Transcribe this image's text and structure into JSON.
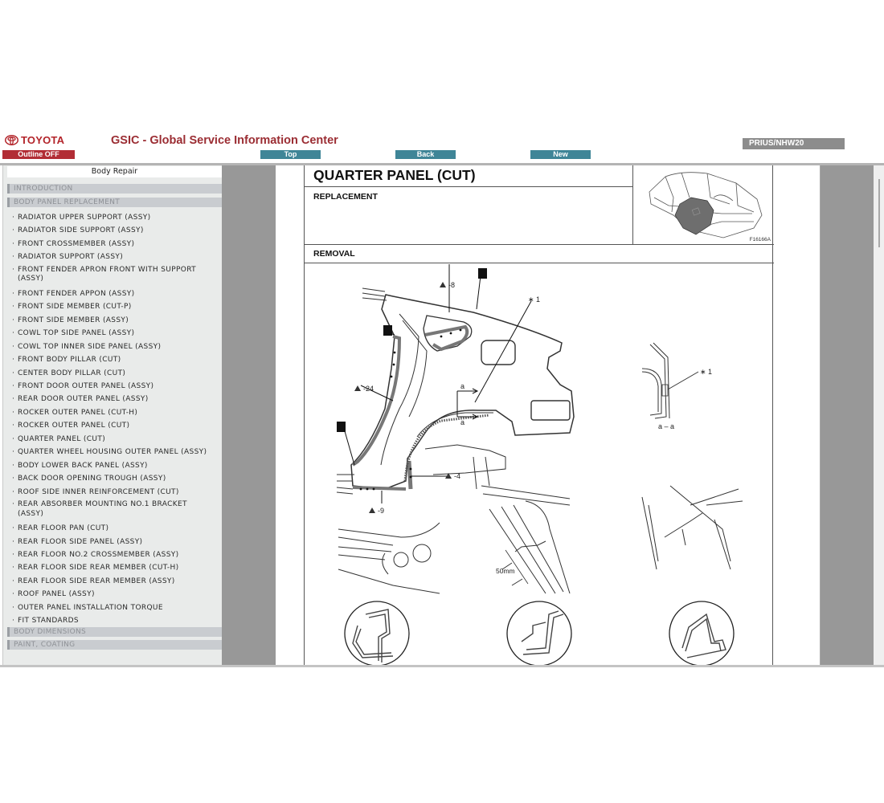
{
  "header": {
    "brand": "TOYOTA",
    "app_title": "GSIC - Global Service Information Center",
    "model": "PRIUS/NHW20",
    "buttons": {
      "outline": "Outline OFF",
      "top": "Top",
      "back": "Back",
      "new": "New"
    },
    "colors": {
      "brand_red": "#b22d35",
      "title_red": "#9b2d33",
      "button_teal": "#3f8597",
      "badge_gray": "#8c8c8c"
    }
  },
  "sidebar": {
    "title": "Body Repair",
    "sections_top": [
      "INTRODUCTION",
      "BODY PANEL REPLACEMENT"
    ],
    "items": [
      {
        "label": "RADIATOR UPPER SUPPORT (ASSY)"
      },
      {
        "label": "RADIATOR SIDE SUPPORT (ASSY)"
      },
      {
        "label": "FRONT CROSSMEMBER (ASSY)"
      },
      {
        "label": "RADIATOR SUPPORT (ASSY)"
      },
      {
        "label": "FRONT FENDER APRON FRONT WITH SUPPORT",
        "cont": "(ASSY)"
      },
      {
        "label": "FRONT FENDER APPON (ASSY)"
      },
      {
        "label": "FRONT SIDE MEMBER (CUT-P)"
      },
      {
        "label": "FRONT SIDE MEMBER (ASSY)"
      },
      {
        "label": "COWL TOP SIDE PANEL (ASSY)"
      },
      {
        "label": "COWL TOP INNER SIDE PANEL (ASSY)"
      },
      {
        "label": "FRONT BODY PILLAR (CUT)"
      },
      {
        "label": "CENTER BODY PILLAR (CUT)"
      },
      {
        "label": "FRONT DOOR OUTER PANEL (ASSY)"
      },
      {
        "label": "REAR DOOR OUTER PANEL (ASSY)"
      },
      {
        "label": "ROCKER OUTER PANEL (CUT-H)"
      },
      {
        "label": "ROCKER OUTER PANEL (CUT)"
      },
      {
        "label": "QUARTER PANEL (CUT)"
      },
      {
        "label": "QUARTER WHEEL HOUSING OUTER PANEL (ASSY)"
      },
      {
        "label": "BODY LOWER BACK PANEL (ASSY)"
      },
      {
        "label": "BACK DOOR OPENING TROUGH (ASSY)"
      },
      {
        "label": "ROOF SIDE INNER REINFORCEMENT (CUT)"
      },
      {
        "label": "REAR ABSORBER MOUNTING NO.1 BRACKET",
        "cont": "(ASSY)"
      },
      {
        "label": "REAR FLOOR PAN (CUT)"
      },
      {
        "label": "REAR FLOOR SIDE PANEL (ASSY)"
      },
      {
        "label": "REAR FLOOR NO.2 CROSSMEMBER (ASSY)"
      },
      {
        "label": "REAR FLOOR SIDE REAR MEMBER (CUT-H)"
      },
      {
        "label": "REAR FLOOR SIDE REAR MEMBER (ASSY)"
      },
      {
        "label": "ROOF PANEL (ASSY)"
      },
      {
        "label": "OUTER PANEL INSTALLATION TORQUE"
      },
      {
        "label": "FIT STANDARDS"
      }
    ],
    "sections_bottom": [
      "BODY DIMENSIONS",
      "PAINT, COATING"
    ]
  },
  "document": {
    "title": "QUARTER PANEL (CUT)",
    "subtitle": "REPLACEMENT",
    "thumbnail_code": "F16166A",
    "section": "REMOVAL",
    "callouts": {
      "weld_8": "-8",
      "weld_24": "-24",
      "weld_4": "-4",
      "weld_9": "-9",
      "note_1": "∗ 1",
      "section_a": "a",
      "section_label": "a – a",
      "dimension": "50mm"
    }
  }
}
